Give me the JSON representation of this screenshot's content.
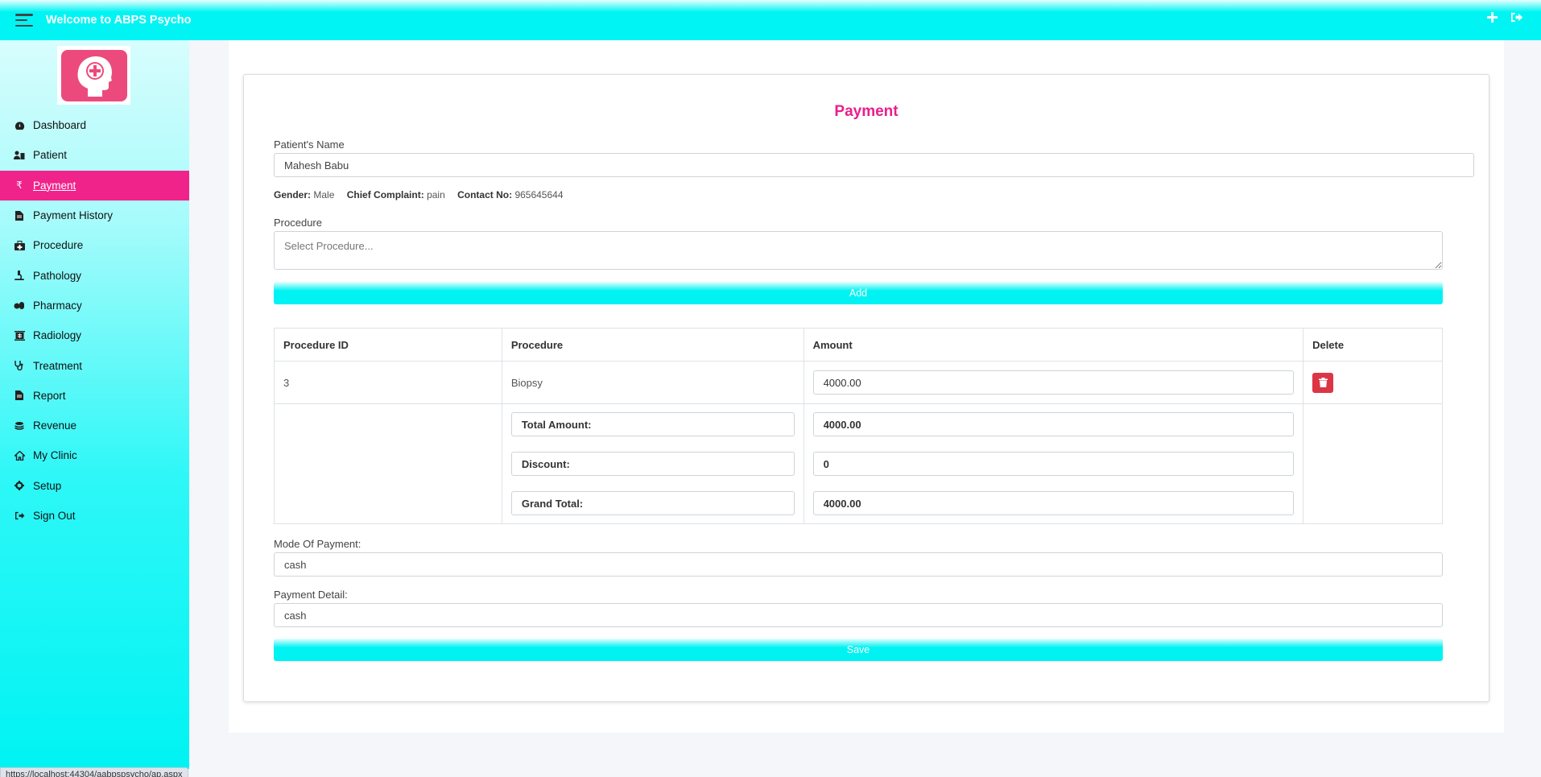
{
  "header": {
    "title": "Welcome to ABPS Psycho"
  },
  "sidebar": {
    "items": [
      {
        "label": "Dashboard",
        "icon": "dashboard-icon"
      },
      {
        "label": "Patient",
        "icon": "patient-icon"
      },
      {
        "label": "Payment",
        "icon": "rupee-icon",
        "active": true
      },
      {
        "label": "Payment History",
        "icon": "file-icon"
      },
      {
        "label": "Procedure",
        "icon": "medkit-icon"
      },
      {
        "label": "Pathology",
        "icon": "microscope-icon"
      },
      {
        "label": "Pharmacy",
        "icon": "pills-icon"
      },
      {
        "label": "Radiology",
        "icon": "xray-icon"
      },
      {
        "label": "Treatment",
        "icon": "stethoscope-icon"
      },
      {
        "label": "Report",
        "icon": "file-icon"
      },
      {
        "label": "Revenue",
        "icon": "coins-icon"
      },
      {
        "label": "My Clinic",
        "icon": "home-icon"
      },
      {
        "label": "Setup",
        "icon": "gear-icon"
      },
      {
        "label": "Sign Out",
        "icon": "sign-out-icon"
      }
    ]
  },
  "form": {
    "title": "Payment",
    "patient_name_label": "Patient's Name",
    "patient_name_value": "Mahesh Babu",
    "gender_label": "Gender:",
    "gender_value": "Male",
    "complaint_label": "Chief Complaint:",
    "complaint_value": "pain",
    "contact_label": "Contact No:",
    "contact_value": "965645644",
    "procedure_label": "Procedure",
    "procedure_placeholder": "Select Procedure...",
    "add_label": "Add",
    "mode_label": "Mode Of Payment:",
    "mode_value": "cash",
    "detail_label": "Payment Detail:",
    "detail_value": "cash",
    "save_label": "Save"
  },
  "table": {
    "headers": [
      "Procedure ID",
      "Procedure",
      "Amount",
      "Delete"
    ],
    "rows": [
      {
        "id": "3",
        "procedure": "Biopsy",
        "amount": "4000.00"
      }
    ],
    "total_label": "Total Amount:",
    "total_value": "4000.00",
    "discount_label": "Discount:",
    "discount_value": "0",
    "grand_label": "Grand Total:",
    "grand_value": "4000.00"
  },
  "statusbar": {
    "url": "https://localhost:44304/aabpspsycho/ap.aspx"
  },
  "colors": {
    "accent": "#00f4f4",
    "active_nav": "#f0238a",
    "title": "#e91e8c",
    "danger": "#dc3545",
    "logo": "#ec4a7d"
  }
}
